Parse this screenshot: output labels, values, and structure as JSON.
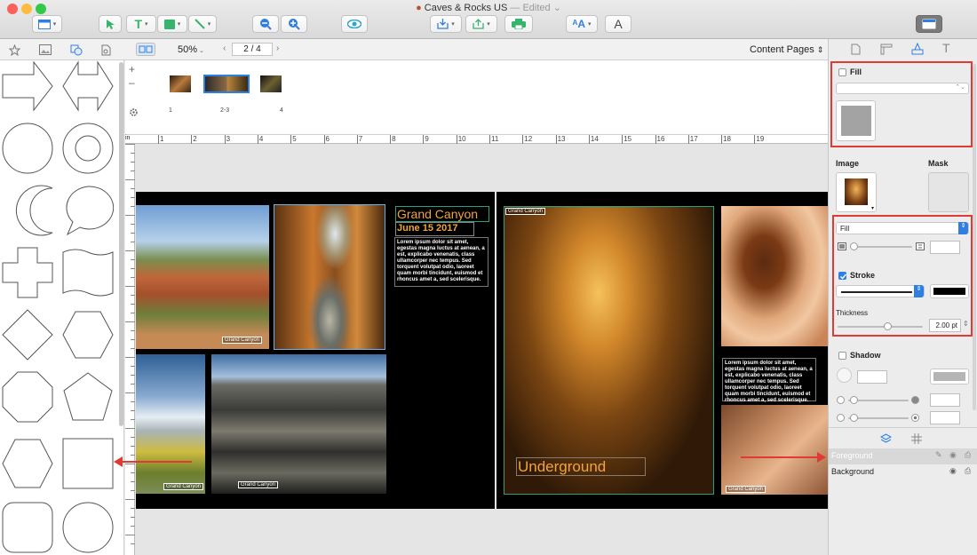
{
  "window": {
    "title": "Caves & Rocks US",
    "edited": "— Edited"
  },
  "toolbar": {
    "zoom_value": "50%",
    "page_field": "2 / 4",
    "content_pages": "Content Pages",
    "font_button_a": "A",
    "text_tool": "T"
  },
  "shape_tabs": [
    "star-shapes-tab",
    "image-tab",
    "shapes-tab",
    "clipart-tab"
  ],
  "thumbs": {
    "labels": [
      "1",
      "2-3",
      "4"
    ]
  },
  "ruler": {
    "unit": "in",
    "ticks": [
      "1",
      "2",
      "3",
      "4",
      "5",
      "6",
      "7",
      "8",
      "9",
      "10",
      "11",
      "12",
      "13",
      "14",
      "15",
      "16",
      "17",
      "18",
      "19"
    ]
  },
  "page_left": {
    "heading": "Grand Canyon",
    "date": "June 15 2017",
    "lorem": "Lorem ipsum dolor sit amet, egestas magna luctus at aenean, a est, explicabo venenatis, class ullamcorper nec tempus. Sed torquent volutpat odio, laoreet quam morbi tincidunt, euismod et rhoncus amet a, sed scelerisque.",
    "captions": [
      "Grand Canyon",
      "Grand Canyon",
      "Grand Canyon"
    ]
  },
  "page_right": {
    "caption_top": "Grand Canyon",
    "underground": "Underground",
    "lorem": "Lorem ipsum dolor sit amet, egestas magna luctus at aenean, a est, explicabo venenatis, class ullamcorper nec tempus. Sed torquent volutpat odio, laoreet quam morbi tincidunt, euismod et rhoncus amet a, sed scelerisque.",
    "caption_bottom": "Grand Canyon"
  },
  "inspector": {
    "fill_label": "Fill",
    "image_label": "Image",
    "mask_label": "Mask",
    "fill_select": "Fill",
    "stroke_label": "Stroke",
    "thickness_label": "Thickness",
    "thickness_value": "2.00 pt",
    "shadow_label": "Shadow",
    "stroke_color": "#000000",
    "accent": "#2f7fe0",
    "highlight": "#e03a34"
  },
  "layers": [
    {
      "name": "Foreground",
      "selected": true
    },
    {
      "name": "Background",
      "selected": false
    }
  ]
}
